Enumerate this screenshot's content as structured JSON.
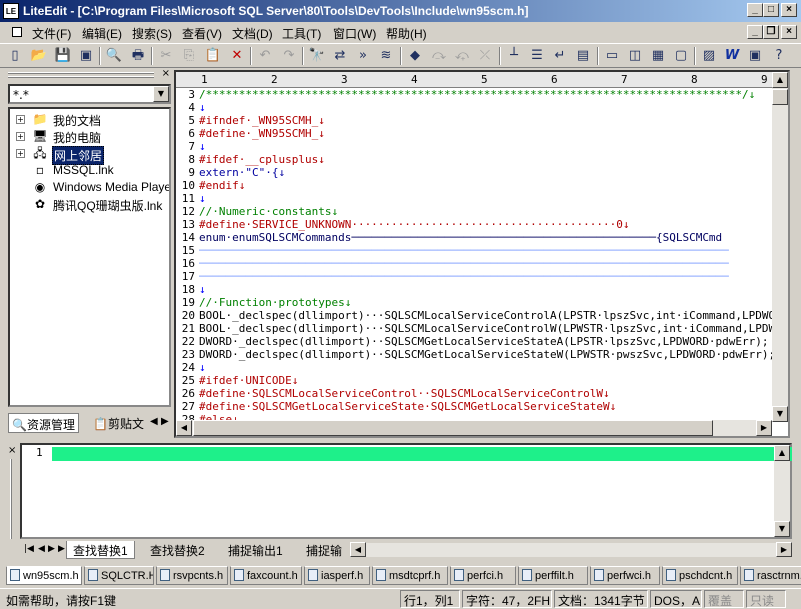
{
  "window": {
    "app_icon": "LE",
    "title": "LiteEdit - [C:\\Program Files\\Microsoft SQL Server\\80\\Tools\\DevTools\\Include\\wn95scm.h]"
  },
  "menu": {
    "items": [
      {
        "label": "文件(F)"
      },
      {
        "label": "编辑(E)"
      },
      {
        "label": "搜索(S)"
      },
      {
        "label": "查看(V)"
      },
      {
        "label": "文档(D)"
      },
      {
        "label": "工具(T)"
      },
      {
        "label": "窗口(W)"
      },
      {
        "label": "帮助(H)"
      }
    ]
  },
  "toolbar": {
    "icons": [
      "new-file-icon",
      "open-folder-icon",
      "save-icon",
      "save-all-icon",
      "print-preview-icon",
      "print-icon",
      "cut-icon",
      "copy-icon",
      "paste-icon",
      "delete-icon",
      "undo-icon",
      "redo-icon",
      "find-icon",
      "find-replace-icon",
      "find-next-icon",
      "find-in-files-icon",
      "bookmark-icon",
      "bookmark-next-icon",
      "bookmark-prev-icon",
      "bookmark-clear-icon",
      "ruler-icon",
      "line-numbers-icon",
      "word-wrap-icon",
      "whitespace-icon",
      "split-horizontal-icon",
      "split-vertical-icon",
      "window-list-icon",
      "full-screen-icon",
      "output-panel-icon",
      "word-icon",
      "options-icon",
      "help-icon"
    ],
    "glyphs": [
      "▯",
      "📂",
      "💾",
      "▣",
      "🔍",
      "🖶",
      "✂",
      "⎘",
      "📋",
      "✕",
      "↶",
      "↷",
      "🔭",
      "⇄",
      "»",
      "≋",
      "◆",
      "⤼",
      "⤽",
      "⤫",
      "┴",
      "☰",
      "↵",
      "▤",
      "▭",
      "◫",
      "▦",
      "▢",
      "▨",
      "W",
      "▣",
      "?"
    ]
  },
  "left_panel": {
    "close_glyph": "×",
    "filter_value": "*.*",
    "tree": [
      {
        "label": "我的文档",
        "icon": "folder-icon",
        "glyph": "📁",
        "expand": "+",
        "selected": false
      },
      {
        "label": "我的电脑",
        "icon": "computer-icon",
        "glyph": "🖥",
        "expand": "+",
        "selected": false
      },
      {
        "label": "网上邻居",
        "icon": "network-icon",
        "glyph": "🖧",
        "expand": "+",
        "selected": true
      },
      {
        "label": "MSSQL.lnk",
        "icon": "shortcut-file-icon",
        "glyph": "▫",
        "expand": "",
        "selected": false
      },
      {
        "label": "Windows Media Player.lnk",
        "icon": "media-player-icon",
        "glyph": "◉",
        "expand": "",
        "selected": false
      },
      {
        "label": "腾讯QQ珊瑚虫版.lnk",
        "icon": "qq-icon",
        "glyph": "✿",
        "expand": "",
        "selected": false
      }
    ],
    "tabs": [
      {
        "label": "资源管理"
      },
      {
        "label": "剪贴文"
      }
    ]
  },
  "editor": {
    "ruler": [
      "1",
      "2",
      "3",
      "4",
      "5",
      "6",
      "7",
      "8",
      "9"
    ],
    "lines": [
      {
        "n": "3",
        "text": "/*********************************************************************************/↓",
        "color": "#008000"
      },
      {
        "n": "4",
        "text": "↓",
        "color": "#0000ff"
      },
      {
        "n": "5",
        "text": "#ifndef·_WN95SCMH_↓",
        "color": "#b00000"
      },
      {
        "n": "6",
        "text": "#define·_WN95SCMH_↓",
        "color": "#b00000"
      },
      {
        "n": "7",
        "text": "↓",
        "color": "#0000ff"
      },
      {
        "n": "8",
        "text": "#ifdef·__cplusplus↓",
        "color": "#b00000"
      },
      {
        "n": "9",
        "text": "extern·\"C\"·{↓",
        "color": "#0000a0"
      },
      {
        "n": "10",
        "text": "#endif↓",
        "color": "#b00000"
      },
      {
        "n": "11",
        "text": "↓",
        "color": "#0000ff"
      },
      {
        "n": "12",
        "text": "//·Numeric·constants↓",
        "color": "#008000"
      },
      {
        "n": "13",
        "text": "#define·SERVICE_UNKNOWN········································0↓",
        "color": "#b00000"
      },
      {
        "n": "14",
        "text": "enum·enumSQLSCMCommands──────────────────────────────────────────────{SQLSCMCmd",
        "color": "#000060"
      },
      {
        "n": "15",
        "text": "────────────────────────────────────────────────────────────────────────────────",
        "color": "#80a0ff"
      },
      {
        "n": "16",
        "text": "────────────────────────────────────────────────────────────────────────────────",
        "color": "#80a0ff"
      },
      {
        "n": "17",
        "text": "────────────────────────────────────────────────────────────────────────────────",
        "color": "#80a0ff"
      },
      {
        "n": "18",
        "text": "↓",
        "color": "#0000ff"
      },
      {
        "n": "19",
        "text": "//·Function·prototypes↓",
        "color": "#008000"
      },
      {
        "n": "20",
        "text": "BOOL·_declspec(dllimport)···SQLSCMLocalServiceControlA(LPSTR·lpszSvc,int·iCommand,LPDWORD",
        "color": "#000000"
      },
      {
        "n": "21",
        "text": "BOOL·_declspec(dllimport)···SQLSCMLocalServiceControlW(LPWSTR·lpszSvc,int·iCommand,LPDWORD",
        "color": "#000000"
      },
      {
        "n": "22",
        "text": "DWORD·_declspec(dllimport)··SQLSCMGetLocalServiceStateA(LPSTR·lpszSvc,LPDWORD·pdwErr);",
        "color": "#000000"
      },
      {
        "n": "23",
        "text": "DWORD·_declspec(dllimport)··SQLSCMGetLocalServiceStateW(LPWSTR·pwszSvc,LPDWORD·pdwErr);",
        "color": "#000000"
      },
      {
        "n": "24",
        "text": "↓",
        "color": "#0000ff"
      },
      {
        "n": "25",
        "text": "#ifdef·UNICODE↓",
        "color": "#b00000"
      },
      {
        "n": "26",
        "text": "#define·SQLSCMLocalServiceControl··SQLSCMLocalServiceControlW↓",
        "color": "#b00000"
      },
      {
        "n": "27",
        "text": "#define·SQLSCMGetLocalServiceState·SQLSCMGetLocalServiceStateW↓",
        "color": "#b00000"
      },
      {
        "n": "28",
        "text": "#else↓",
        "color": "#b00000"
      }
    ]
  },
  "output": {
    "close_glyph": "×",
    "line_number": "1",
    "tabs": [
      {
        "label": "查找替换1",
        "active": true
      },
      {
        "label": "查找替换2",
        "active": false
      },
      {
        "label": "捕捉输出1",
        "active": false
      },
      {
        "label": "捕捉输",
        "active": false
      }
    ]
  },
  "file_tabs": [
    {
      "label": "wn95scm.h"
    },
    {
      "label": "SQLCTR.H"
    },
    {
      "label": "rsvpcnts.h"
    },
    {
      "label": "faxcount.h"
    },
    {
      "label": "iasperf.h"
    },
    {
      "label": "msdtcprf.h"
    },
    {
      "label": "perfci.h"
    },
    {
      "label": "perffilt.h"
    },
    {
      "label": "perfwci.h"
    },
    {
      "label": "pschdcnt.h"
    },
    {
      "label": "rasctrnm.h"
    }
  ],
  "status": {
    "help": "如需帮助，请按F1键",
    "position": "行1，列1",
    "char": "字符：47，2FH",
    "doc": "文档：1341字节",
    "mode": "DOS，A",
    "overwrite": "覆盖",
    "readonly": "只读"
  }
}
